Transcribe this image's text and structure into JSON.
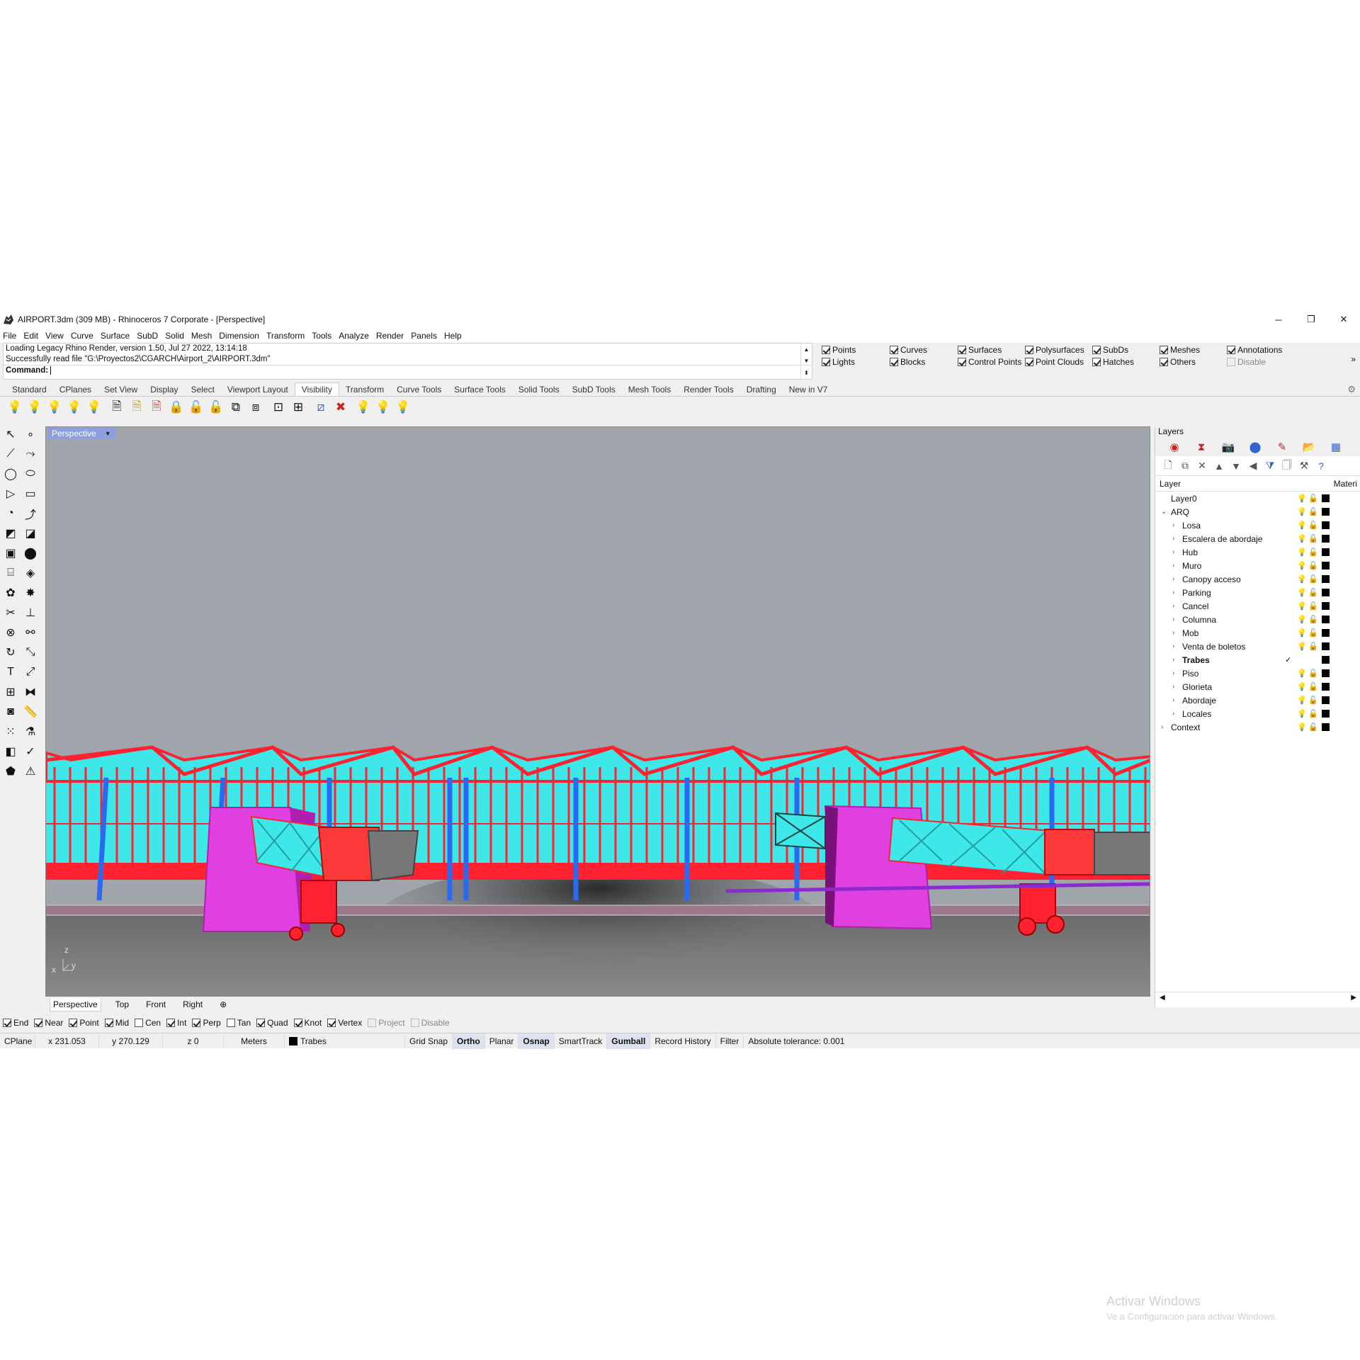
{
  "window": {
    "title": "AIRPORT.3dm (309 MB) - Rhinoceros 7 Corporate - [Perspective]",
    "minimize": "─",
    "restore": "❐",
    "close": "✕"
  },
  "menu": [
    "File",
    "Edit",
    "View",
    "Curve",
    "Surface",
    "SubD",
    "Solid",
    "Mesh",
    "Dimension",
    "Transform",
    "Tools",
    "Analyze",
    "Render",
    "Panels",
    "Help"
  ],
  "command": {
    "history": [
      "Loading Legacy Rhino Render, version 1.50, Jul 27 2022, 13:14:18",
      "Successfully read file \"G:\\Proyectos2\\CGARCH\\Airport_2\\AIRPORT.3dm\""
    ],
    "prompt": "Command:"
  },
  "filters": [
    {
      "label": "Points",
      "checked": true
    },
    {
      "label": "Lights",
      "checked": true
    },
    {
      "label": "Curves",
      "checked": true
    },
    {
      "label": "Blocks",
      "checked": true
    },
    {
      "label": "Surfaces",
      "checked": true
    },
    {
      "label": "Control Points",
      "checked": true
    },
    {
      "label": "Polysurfaces",
      "checked": true
    },
    {
      "label": "Point Clouds",
      "checked": true
    },
    {
      "label": "SubDs",
      "checked": true
    },
    {
      "label": "Hatches",
      "checked": true
    },
    {
      "label": "Meshes",
      "checked": true
    },
    {
      "label": "Others",
      "checked": true
    },
    {
      "label": "Annotations",
      "checked": true
    },
    {
      "label": "Disable",
      "checked": false
    }
  ],
  "filters_more": "»",
  "tabs": [
    "Standard",
    "CPlanes",
    "Set View",
    "Display",
    "Select",
    "Viewport Layout",
    "Visibility",
    "Transform",
    "Curve Tools",
    "Surface Tools",
    "Solid Tools",
    "SubD Tools",
    "Mesh Tools",
    "Render Tools",
    "Drafting",
    "New in V7"
  ],
  "active_tab": "Visibility",
  "viewport": {
    "name": "Perspective",
    "axis_z": "z",
    "axis_x": "x",
    "axis_y": "y"
  },
  "viewport_tabs": [
    "Perspective",
    "Top",
    "Front",
    "Right"
  ],
  "viewport_add": "⊕",
  "osnaps": [
    {
      "label": "End",
      "checked": true
    },
    {
      "label": "Near",
      "checked": true
    },
    {
      "label": "Point",
      "checked": true
    },
    {
      "label": "Mid",
      "checked": true
    },
    {
      "label": "Cen",
      "checked": false
    },
    {
      "label": "Int",
      "checked": true
    },
    {
      "label": "Perp",
      "checked": true
    },
    {
      "label": "Tan",
      "checked": false
    },
    {
      "label": "Quad",
      "checked": true
    },
    {
      "label": "Knot",
      "checked": true
    },
    {
      "label": "Vertex",
      "checked": true
    },
    {
      "label": "Project",
      "checked": false
    },
    {
      "label": "Disable",
      "checked": false
    }
  ],
  "status": {
    "cplane": "CPlane",
    "x": "x 231.053",
    "y": "y 270.129",
    "z": "z 0",
    "units": "Meters",
    "layer": "Trabes",
    "grid_snap": "Grid Snap",
    "ortho": "Ortho",
    "planar": "Planar",
    "osnap": "Osnap",
    "smarttrack": "SmartTrack",
    "gumball": "Gumball",
    "record_history": "Record History",
    "filter": "Filter",
    "tolerance": "Absolute tolerance: 0.001"
  },
  "layers": {
    "panel_title": "Layers",
    "col_layer": "Layer",
    "col_material": "Materi",
    "current_mark": "✓",
    "rows": [
      {
        "name": "Layer0",
        "level": 0,
        "expander": ""
      },
      {
        "name": "ARQ",
        "level": 0,
        "expander": "⌄"
      },
      {
        "name": "Losa",
        "level": 1,
        "expander": "›"
      },
      {
        "name": "Escalera de abordaje",
        "level": 1,
        "expander": "›"
      },
      {
        "name": "Hub",
        "level": 1,
        "expander": "›"
      },
      {
        "name": "Muro",
        "level": 1,
        "expander": "›"
      },
      {
        "name": "Canopy acceso",
        "level": 1,
        "expander": "›"
      },
      {
        "name": "Parking",
        "level": 1,
        "expander": "›"
      },
      {
        "name": "Cancel",
        "level": 1,
        "expander": "›"
      },
      {
        "name": "Columna",
        "level": 1,
        "expander": "›"
      },
      {
        "name": "Mob",
        "level": 1,
        "expander": "›"
      },
      {
        "name": "Venta de boletos",
        "level": 1,
        "expander": "›"
      },
      {
        "name": "Trabes",
        "level": 1,
        "expander": "›",
        "current": true
      },
      {
        "name": "Piso",
        "level": 1,
        "expander": "›"
      },
      {
        "name": "Glorieta",
        "level": 1,
        "expander": "›"
      },
      {
        "name": "Abordaje",
        "level": 1,
        "expander": "›"
      },
      {
        "name": "Locales",
        "level": 1,
        "expander": "›"
      },
      {
        "name": "Context",
        "level": 0,
        "expander": "›"
      }
    ]
  },
  "watermark": {
    "line1": "Activar Windows",
    "line2": "Ve a Configuración para activar Windows."
  },
  "colors": {
    "viewport_sky": "#a0a4ab",
    "glass": "#3ee8e8",
    "frame": "#ff2030",
    "column": "#2a6af0",
    "bridge_body": "#e040e0"
  }
}
